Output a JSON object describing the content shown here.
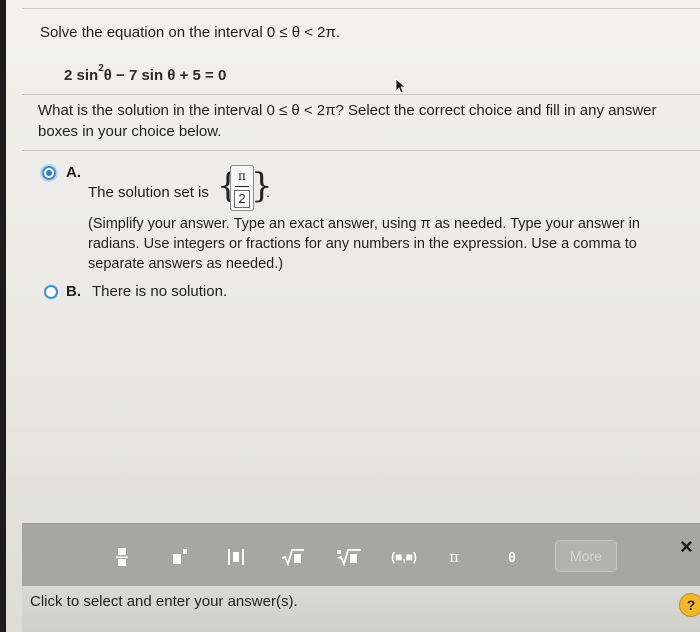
{
  "problem": {
    "title": "Solve the equation on the interval 0 ≤ θ < 2π.",
    "equation_pre": "2 sin",
    "equation_exp": "2",
    "equation_post": "θ − 7 sin θ + 5 = 0",
    "question": "What is the solution in the interval 0 ≤ θ < 2π? Select the correct choice and fill in any answer boxes in your choice below."
  },
  "option_a": {
    "letter": "A.",
    "selected": true,
    "lead": "The solution set is",
    "numerator": "π",
    "denominator": "2",
    "brace_left": "{",
    "brace_right": "}",
    "end": ".",
    "hint": "(Simplify your answer. Type an exact answer, using π as needed. Type your answer in radians. Use integers or fractions for any numbers in the expression. Use a comma to separate answers as needed.)"
  },
  "option_b": {
    "letter": "B.",
    "selected": false,
    "text": "There is no solution."
  },
  "toolbar": {
    "tools": [
      {
        "icon": "fraction-icon"
      },
      {
        "icon": "exponent-icon"
      },
      {
        "icon": "absolute-value-icon"
      },
      {
        "icon": "square-root-icon"
      },
      {
        "icon": "nth-root-icon"
      },
      {
        "icon": "interval-icon",
        "label": "(■,■)"
      },
      {
        "icon": "pi-icon",
        "label": "π"
      },
      {
        "icon": "theta-icon",
        "label": "θ"
      }
    ],
    "more_label": "More",
    "close_label": "×"
  },
  "footer": {
    "text": "Click to select and enter your answer(s).",
    "help_label": "?"
  },
  "colors": {
    "radio_accent": "#2f7fc8",
    "toolbar_bg": "#a6a6a4",
    "help_bg": "#f3b72b"
  }
}
